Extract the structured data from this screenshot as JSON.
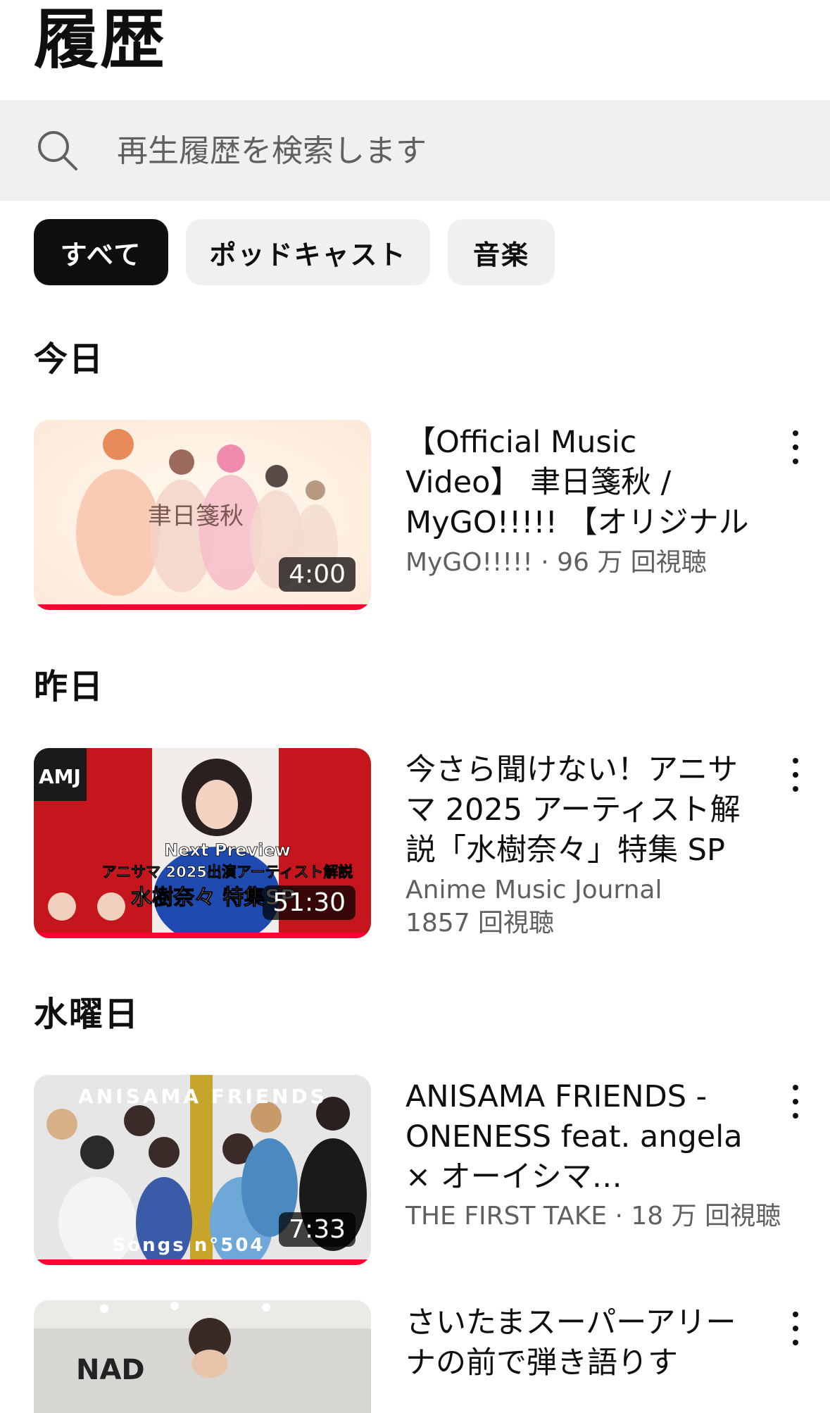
{
  "header": {
    "title": "履歴"
  },
  "search": {
    "placeholder": "再生履歴を検索します"
  },
  "chips": [
    {
      "label": "すべて",
      "selected": true
    },
    {
      "label": "ポッドキャスト",
      "selected": false
    },
    {
      "label": "音楽",
      "selected": false
    }
  ],
  "sections": [
    {
      "label": "今日",
      "videos": [
        {
          "title": "【Official Music Video】 聿日箋秋 / MyGO!!!!! 【オリジナル楽曲】",
          "meta": "MyGO!!!!! · 96 万 回視聴",
          "duration": "4:00",
          "thumb_text": "聿日箋秋",
          "watched_fraction": 1.0
        }
      ]
    },
    {
      "label": "昨日",
      "videos": [
        {
          "title": "今さら聞けない！アニサマ 2025 アーティスト解説「水樹奈々」特集 SP",
          "meta_line1": "Anime Music Journal",
          "meta_line2": "1857 回視聴",
          "duration": "51:30",
          "thumb_logo": "AMJ",
          "thumb_text1": "Next Preview",
          "thumb_text2": "アニサマ 2025出演アーティスト解説",
          "thumb_text3": "水樹奈々 特集SP",
          "watched_fraction": 1.0
        }
      ]
    },
    {
      "label": "水曜日",
      "videos": [
        {
          "title": "ANISAMA FRIENDS - ONENESS feat. angela × オーイシマ…",
          "meta": "THE FIRST TAKE · 18 万 回視聴",
          "duration": "7:33",
          "thumb_text1": "ANISAMA FRIENDS",
          "thumb_text2": "Songs n°504",
          "watched_fraction": 1.0
        },
        {
          "title": "さいたまスーパーアリーナの前で弾き語りす",
          "thumb_text": "NAD"
        }
      ]
    }
  ],
  "colors": {
    "progress": "#ff0033",
    "chip_active": "#0f0f0f",
    "chip_bg": "#f0f0f0",
    "secondary_text": "#606060"
  }
}
